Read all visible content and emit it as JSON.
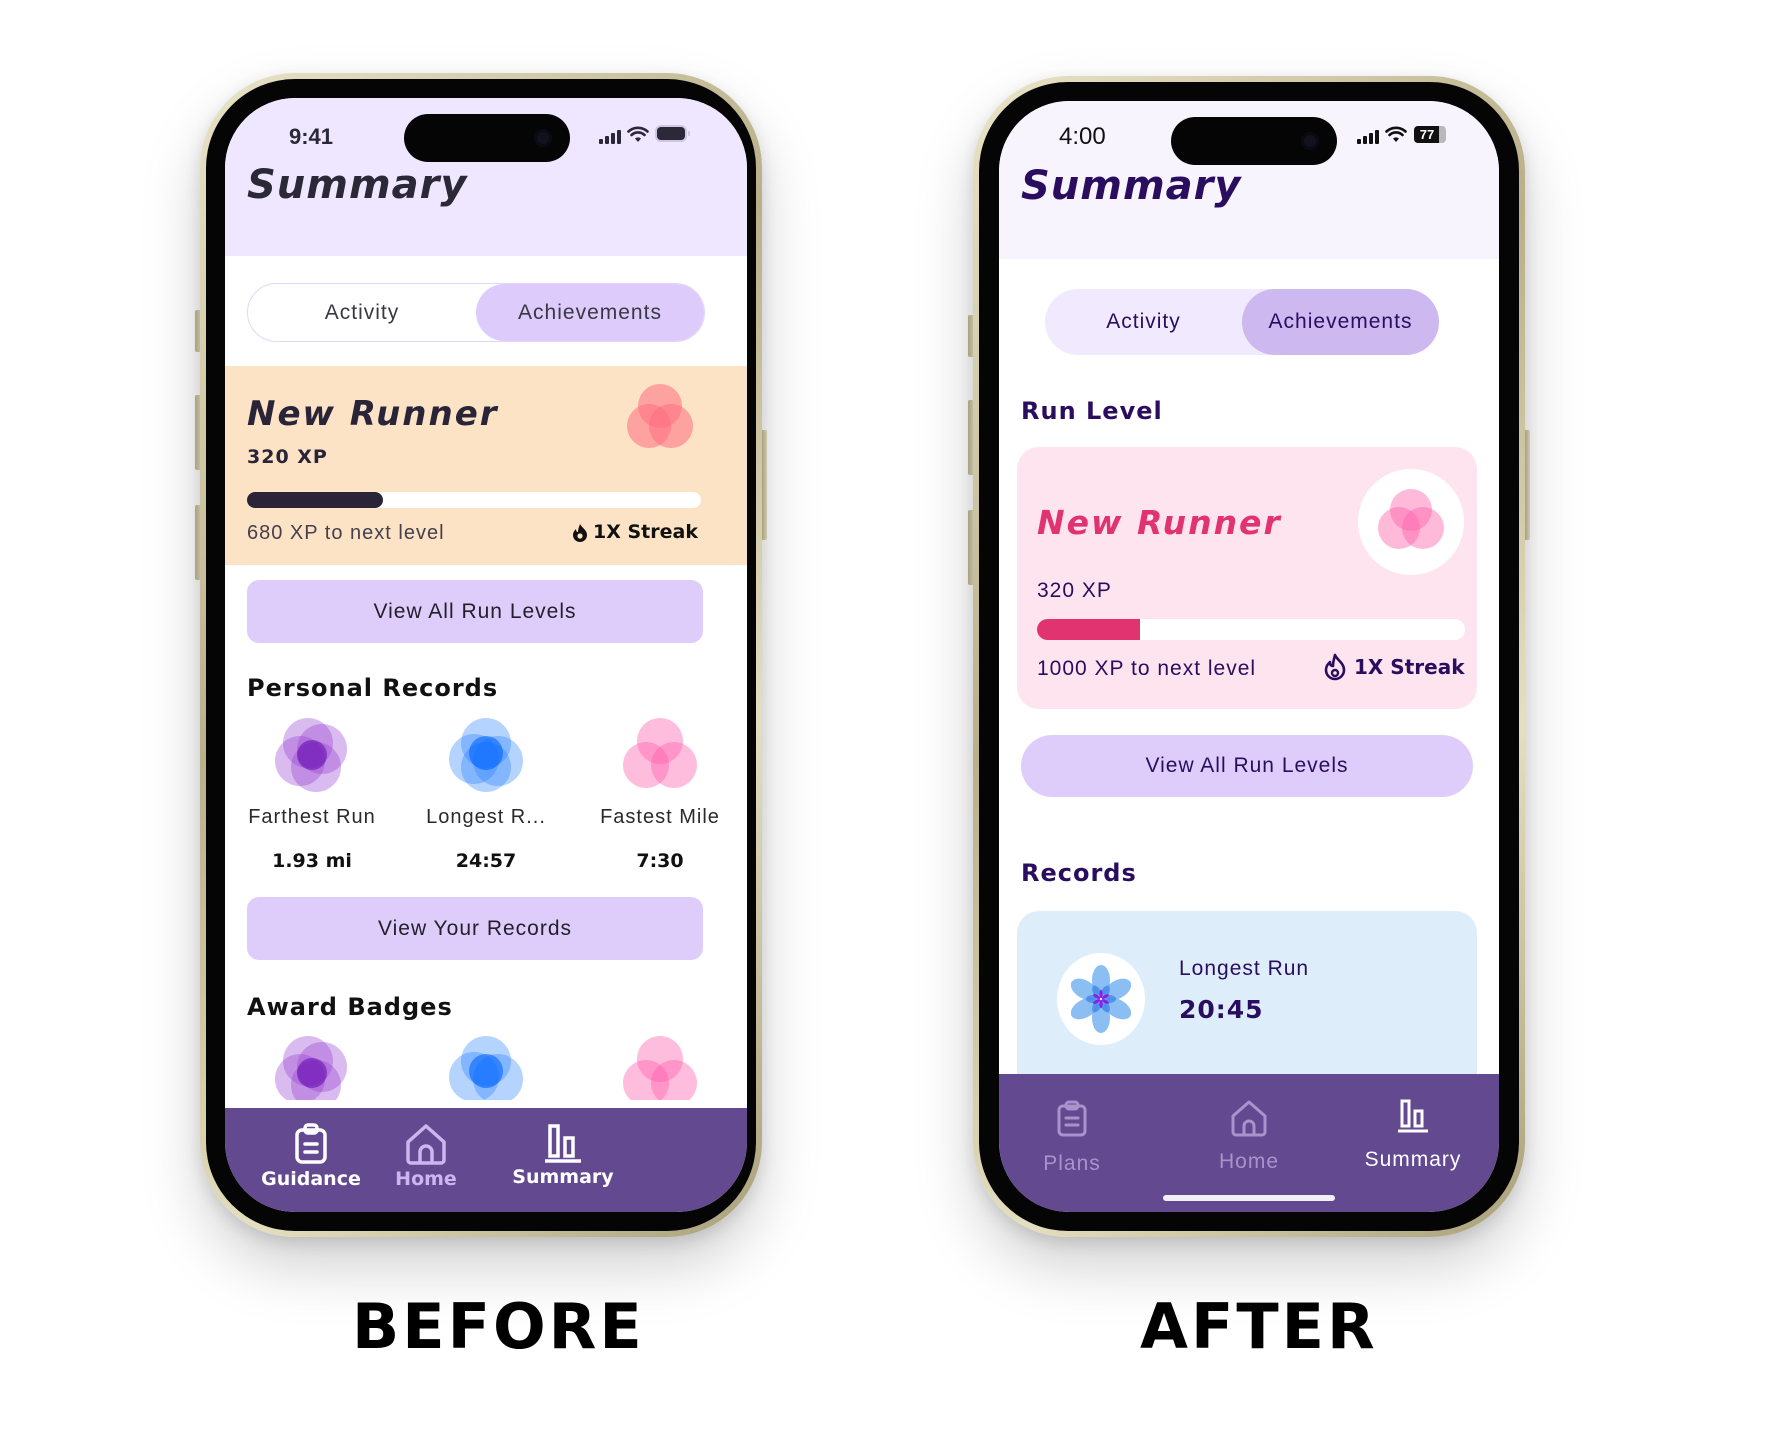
{
  "labels": {
    "before": "BEFORE",
    "after": "AFTER"
  },
  "before": {
    "status": {
      "time": "9:41",
      "signal_icon": "cellular-signal-icon",
      "wifi_icon": "wifi-icon",
      "battery_icon": "battery-icon"
    },
    "header": {
      "title": "Summary"
    },
    "segmented": {
      "tabs": [
        {
          "label": "Activity",
          "selected": false
        },
        {
          "label": "Achievements",
          "selected": true
        }
      ]
    },
    "level_card": {
      "title": "New Runner",
      "xp": "320 XP",
      "progress_percent": 30,
      "next_level_text": "680 XP to next level",
      "streak": "1X Streak",
      "streak_icon": "flame-icon",
      "badge_icon": "pink-flower-badge-icon",
      "colors": {
        "background": "#fde3c6",
        "bar_fill": "#2a2438",
        "bar_track": "#ffffff"
      }
    },
    "view_levels_button": "View All Run Levels",
    "personal_records": {
      "heading": "Personal Records",
      "items": [
        {
          "label": "Farthest Run",
          "value": "1.93 mi",
          "icon": "purple-flower-badge-icon"
        },
        {
          "label": "Longest R...",
          "value": "24:57",
          "icon": "blue-flower-badge-icon"
        },
        {
          "label": "Fastest Mile",
          "value": "7:30",
          "icon": "pink-flower-badge-icon"
        }
      ]
    },
    "view_records_button": "View Your Records",
    "award_badges": {
      "heading": "Award Badges",
      "icons": [
        "purple-flower-badge-icon",
        "blue-flower-badge-icon",
        "pink-flower-badge-icon"
      ]
    },
    "tabbar": {
      "items": [
        {
          "label": "Guidance",
          "icon": "clipboard-icon",
          "active": false
        },
        {
          "label": "Home",
          "icon": "home-icon",
          "active": false
        },
        {
          "label": "Summary",
          "icon": "bar-chart-icon",
          "active": true
        }
      ],
      "colors": {
        "background": "#634a90",
        "active": "#ffffff",
        "inactive": "#cdb6f0"
      }
    }
  },
  "after": {
    "status": {
      "time": "4:00",
      "battery_level": "77",
      "signal_icon": "cellular-signal-icon",
      "wifi_icon": "wifi-icon",
      "battery_icon": "battery-icon"
    },
    "header": {
      "title": "Summary"
    },
    "segmented": {
      "tabs": [
        {
          "label": "Activity",
          "selected": false
        },
        {
          "label": "Achievements",
          "selected": true
        }
      ]
    },
    "run_level": {
      "heading": "Run Level",
      "card": {
        "title": "New Runner",
        "xp": "320 XP",
        "progress_percent": 24,
        "next_level_text": "1000 XP to next level",
        "streak": "1X Streak",
        "streak_icon": "flame-icon",
        "badge_icon": "pink-flower-badge-icon",
        "colors": {
          "background": "#fde4ef",
          "title": "#e0336f",
          "bar_fill": "#e0336f",
          "bar_track": "#ffffff"
        }
      },
      "button": "View All Run Levels"
    },
    "records": {
      "heading": "Records",
      "card": {
        "label": "Longest Run",
        "value": "20:45",
        "icon": "blue-lotus-badge-icon",
        "background": "#ddeefa"
      }
    },
    "tabbar": {
      "items": [
        {
          "label": "Plans",
          "icon": "clipboard-icon",
          "active": false
        },
        {
          "label": "Home",
          "icon": "home-icon",
          "active": false
        },
        {
          "label": "Summary",
          "icon": "bar-chart-icon",
          "active": true
        }
      ],
      "colors": {
        "background": "#634a90",
        "active": "#ffffff",
        "inactive": "#a993cc"
      }
    }
  }
}
